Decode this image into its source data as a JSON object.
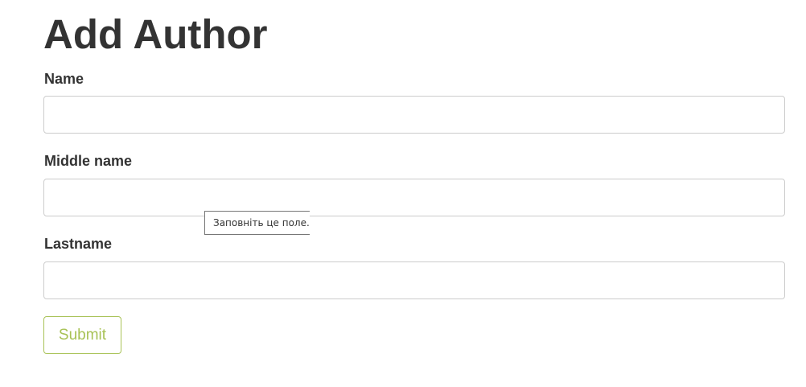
{
  "page": {
    "title": "Add Author"
  },
  "form": {
    "fields": [
      {
        "label": "Name",
        "value": "",
        "placeholder": ""
      },
      {
        "label": "Middle name",
        "value": "",
        "placeholder": ""
      },
      {
        "label": "Lastname",
        "value": "",
        "placeholder": ""
      }
    ],
    "submit_label": "Submit"
  },
  "validation_tooltip": {
    "text": "Заповніть це поле."
  },
  "colors": {
    "text": "#333333",
    "input_border": "#cccccc",
    "submit_accent": "#a8c256"
  }
}
